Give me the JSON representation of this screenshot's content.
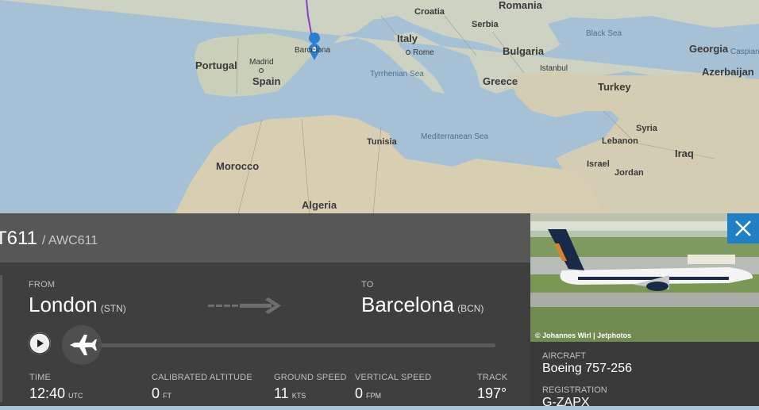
{
  "map": {
    "countries": [
      "Croatia",
      "Romania",
      "Serbia",
      "Italy",
      "Bulgaria",
      "Georgia",
      "Portugal",
      "Spain",
      "Greece",
      "Turkey",
      "Azerbaijan",
      "Tunisia",
      "Syria",
      "Lebanon",
      "Iraq",
      "Israel",
      "Jordan",
      "Morocco",
      "Algeria"
    ],
    "cities": [
      "Madrid",
      "Rome",
      "Istanbul"
    ],
    "seas": [
      "Black Sea",
      "Caspian",
      "Tyrrhenian Sea",
      "Mediterranean Sea"
    ],
    "marker_city": "Barcelona",
    "route_color": "#8a3ec7",
    "marker_color": "#2a7fd0"
  },
  "flight": {
    "callsign": "T611",
    "icao": "/ AWC611"
  },
  "route": {
    "from_label": "FROM",
    "from_city": "London",
    "from_code": "(STN)",
    "to_label": "TO",
    "to_city": "Barcelona",
    "to_code": "(BCN)"
  },
  "stats": {
    "time": {
      "label": "TIME",
      "value": "12:40",
      "unit": "UTC"
    },
    "altitude": {
      "label": "CALIBRATED ALTITUDE",
      "value": "0",
      "unit": "FT"
    },
    "ground_speed": {
      "label": "GROUND SPEED",
      "value": "11",
      "unit": "KTS"
    },
    "vertical_speed": {
      "label": "VERTICAL SPEED",
      "value": "0",
      "unit": "FPM"
    },
    "track": {
      "label": "TRACK",
      "value": "197°"
    }
  },
  "progress": 0.0,
  "photo": {
    "credit": "© Johannes Wirl | Jetphotos"
  },
  "aircraft": {
    "label": "AIRCRAFT",
    "value": "Boeing 757-256",
    "reg_label": "REGISTRATION",
    "reg_value": "G-ZAPX"
  },
  "colors": {
    "accent": "#1f80c5",
    "panel": "#3f3f3f",
    "header": "#575757"
  }
}
